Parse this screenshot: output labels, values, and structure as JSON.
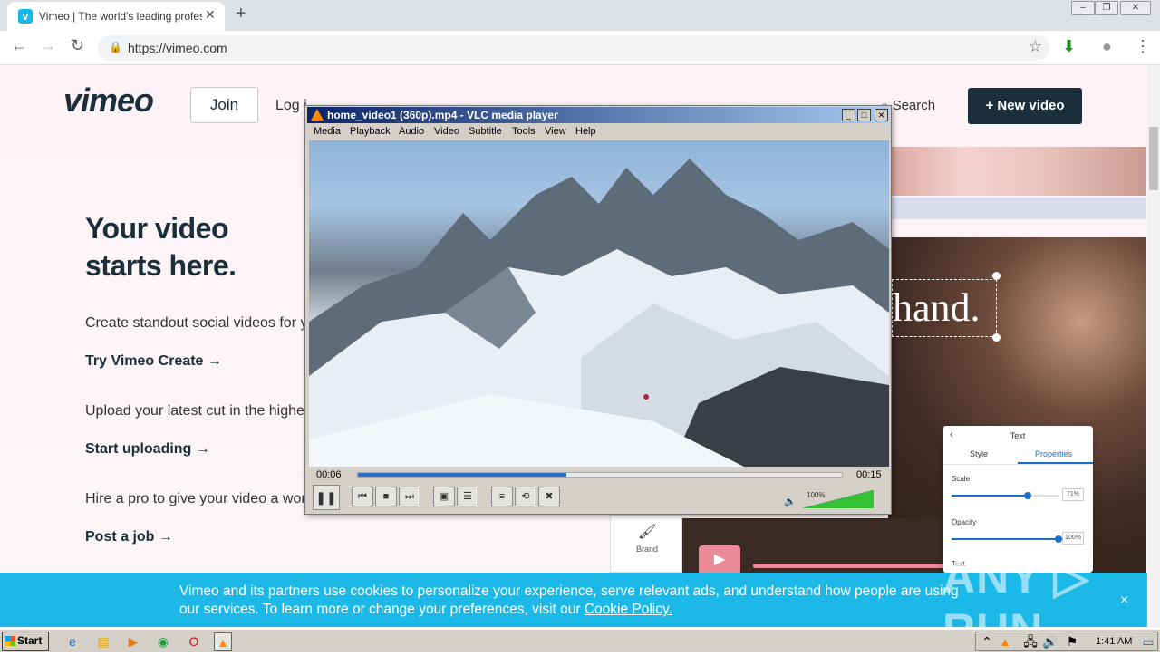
{
  "browser": {
    "tab_title": "Vimeo | The world's leading professio",
    "url": "https://vimeo.com",
    "favicon_letter": "v"
  },
  "vimeo": {
    "logo": "vimeo",
    "join": "Join",
    "login_partial": "Log i",
    "search": "Search",
    "new_video": "New video",
    "headline_line1": "Your video",
    "headline_line2": "starts here.",
    "para1": "Create standout social videos for yo",
    "cta1": "Try Vimeo Create",
    "para2": "Upload your latest cut in the highest",
    "cta2": "Start uploading",
    "para3": "Hire a pro to give your video a world",
    "cta3": "Post a job",
    "arrow": "→",
    "hand_text": "hand.",
    "brand_tile": "Brand",
    "panel": {
      "title": "Text",
      "tab_style": "Style",
      "tab_properties": "Properties",
      "scale_label": "Scale",
      "scale_value": "71%",
      "scale_fraction": 0.71,
      "opacity_label": "Opacity",
      "opacity_value": "100%",
      "opacity_fraction": 1.0,
      "text_label": "Text"
    }
  },
  "cookie": {
    "text_before": "Vimeo and its partners use cookies to personalize your experience, serve relevant ads, and understand how people are using our services. To learn more or change your preferences, visit our ",
    "link": "Cookie Policy.",
    "close": "×"
  },
  "watermark": "ANY ▷ RUN",
  "vlc": {
    "title": "home_video1 (360p).mp4 - VLC media player",
    "menu": [
      "Media",
      "Playback",
      "Audio",
      "Video",
      "Subtitle",
      "Tools",
      "View",
      "Help"
    ],
    "time_elapsed": "00:06",
    "time_total": "00:15",
    "progress_fraction": 0.43,
    "volume_text": "100%",
    "volume_fraction": 1.0
  },
  "taskbar": {
    "start": "Start",
    "clock": "1:41 AM"
  },
  "colors": {
    "vimeo_dark": "#1a2e3b",
    "vimeo_blue": "#1cb9e8",
    "vlc_orange": "#ff8800",
    "seek_blue": "#2f6fcf"
  }
}
